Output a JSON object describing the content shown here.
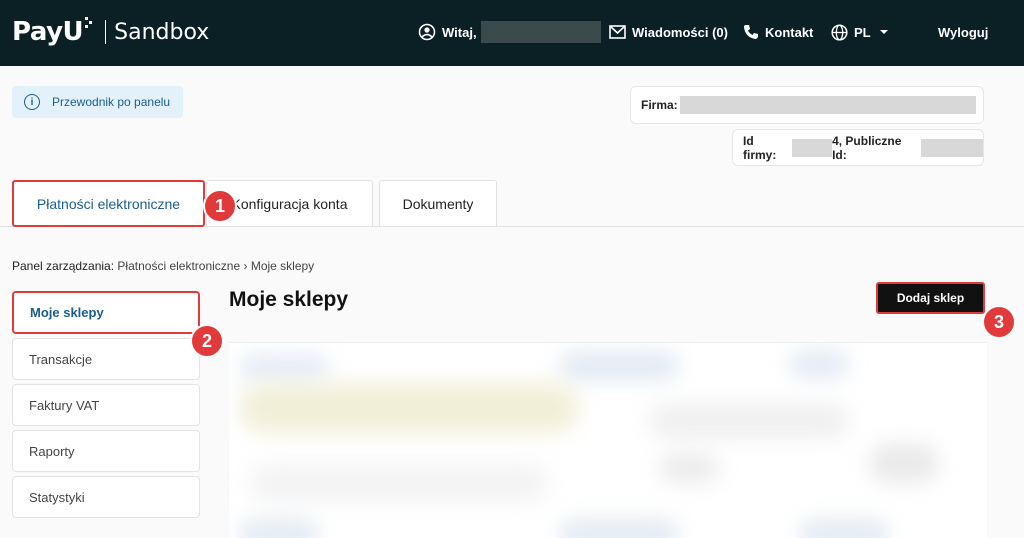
{
  "header": {
    "logo_text": "PayU",
    "env_label": "Sandbox",
    "welcome_label": "Witaj,",
    "messages_label": "Wiadomości (0)",
    "contact_label": "Kontakt",
    "language_label": "PL",
    "logout_label": "Wyloguj"
  },
  "guide": {
    "label": "Przewodnik po panelu"
  },
  "company": {
    "firm_label": "Firma:",
    "id_label": "Id firmy:",
    "id_suffix": "4, Publiczne Id:"
  },
  "tabs": [
    {
      "label": "Płatności elektroniczne",
      "active": true
    },
    {
      "label": "Konfiguracja konta"
    },
    {
      "label": "Dokumenty"
    }
  ],
  "badges": [
    "1",
    "2",
    "3"
  ],
  "breadcrumb": {
    "root": "Panel zarządzania:",
    "rest": "Płatności elektroniczne › Moje sklepy"
  },
  "sidebar": {
    "items": [
      {
        "label": "Moje sklepy",
        "active": true
      },
      {
        "label": "Transakcje"
      },
      {
        "label": "Faktury VAT"
      },
      {
        "label": "Raporty"
      },
      {
        "label": "Statystyki"
      }
    ]
  },
  "main": {
    "title": "Moje sklepy",
    "add_button": "Dodaj sklep"
  },
  "colors": {
    "topbar": "#0a2024",
    "accent": "#1a5e8f",
    "highlight": "#e03a3a"
  }
}
